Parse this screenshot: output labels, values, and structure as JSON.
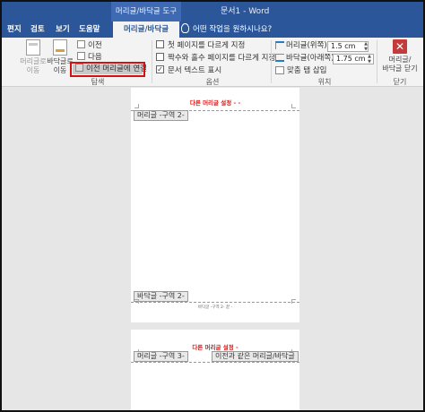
{
  "titlebar": {
    "context_tool": "머리글/바닥글 도구",
    "doc_title": "문서1  -  Word"
  },
  "tabs": [
    {
      "label": "편지"
    },
    {
      "label": "검토"
    },
    {
      "label": "보기"
    },
    {
      "label": "도움말"
    },
    {
      "label": "머리글/바닥글"
    }
  ],
  "tell_me": "어떤 작업을 원하시나요?",
  "ribbon": {
    "navigation": {
      "goto_header": "머리글로\n이동",
      "goto_footer": "바닥글로\n이동",
      "previous": "이전",
      "next": "다음",
      "link_previous": "이전 머리글에 연결",
      "group_label": "탐색"
    },
    "options": {
      "different_first_page": "첫 페이지를 다르게 지정",
      "different_odd_even": "짝수와 홀수 페이지를 다르게 지정",
      "show_document_text": "문서 텍스트 표시",
      "show_document_text_checked": true,
      "group_label": "옵션"
    },
    "position": {
      "header_from_top_label": "머리글(위쪽):",
      "header_from_top_value": "1.5 cm",
      "footer_from_bottom_label": "바닥글(아래쪽):",
      "footer_from_bottom_value": "1.75 cm",
      "insert_alignment_tab": "맞춤 탭 삽입",
      "group_label": "위치"
    },
    "close": {
      "close_label": "머리글/\n바닥글 닫기",
      "group_label": "닫기"
    }
  },
  "document": {
    "page1": {
      "header_text": "다른 머리글 설정 - -",
      "header_section_tag": "머리글 -구역 2-",
      "footer_section_tag": "바닥글 -구역 2-",
      "footer_text": "바닥글 -구역 2- 끝 -"
    },
    "page2": {
      "header_text": "다른 머리글 설정 -",
      "header_section_tag": "머리글 -구역 3-",
      "same_as_previous_tag": "이전과 같은 머리글/바닥글"
    }
  }
}
